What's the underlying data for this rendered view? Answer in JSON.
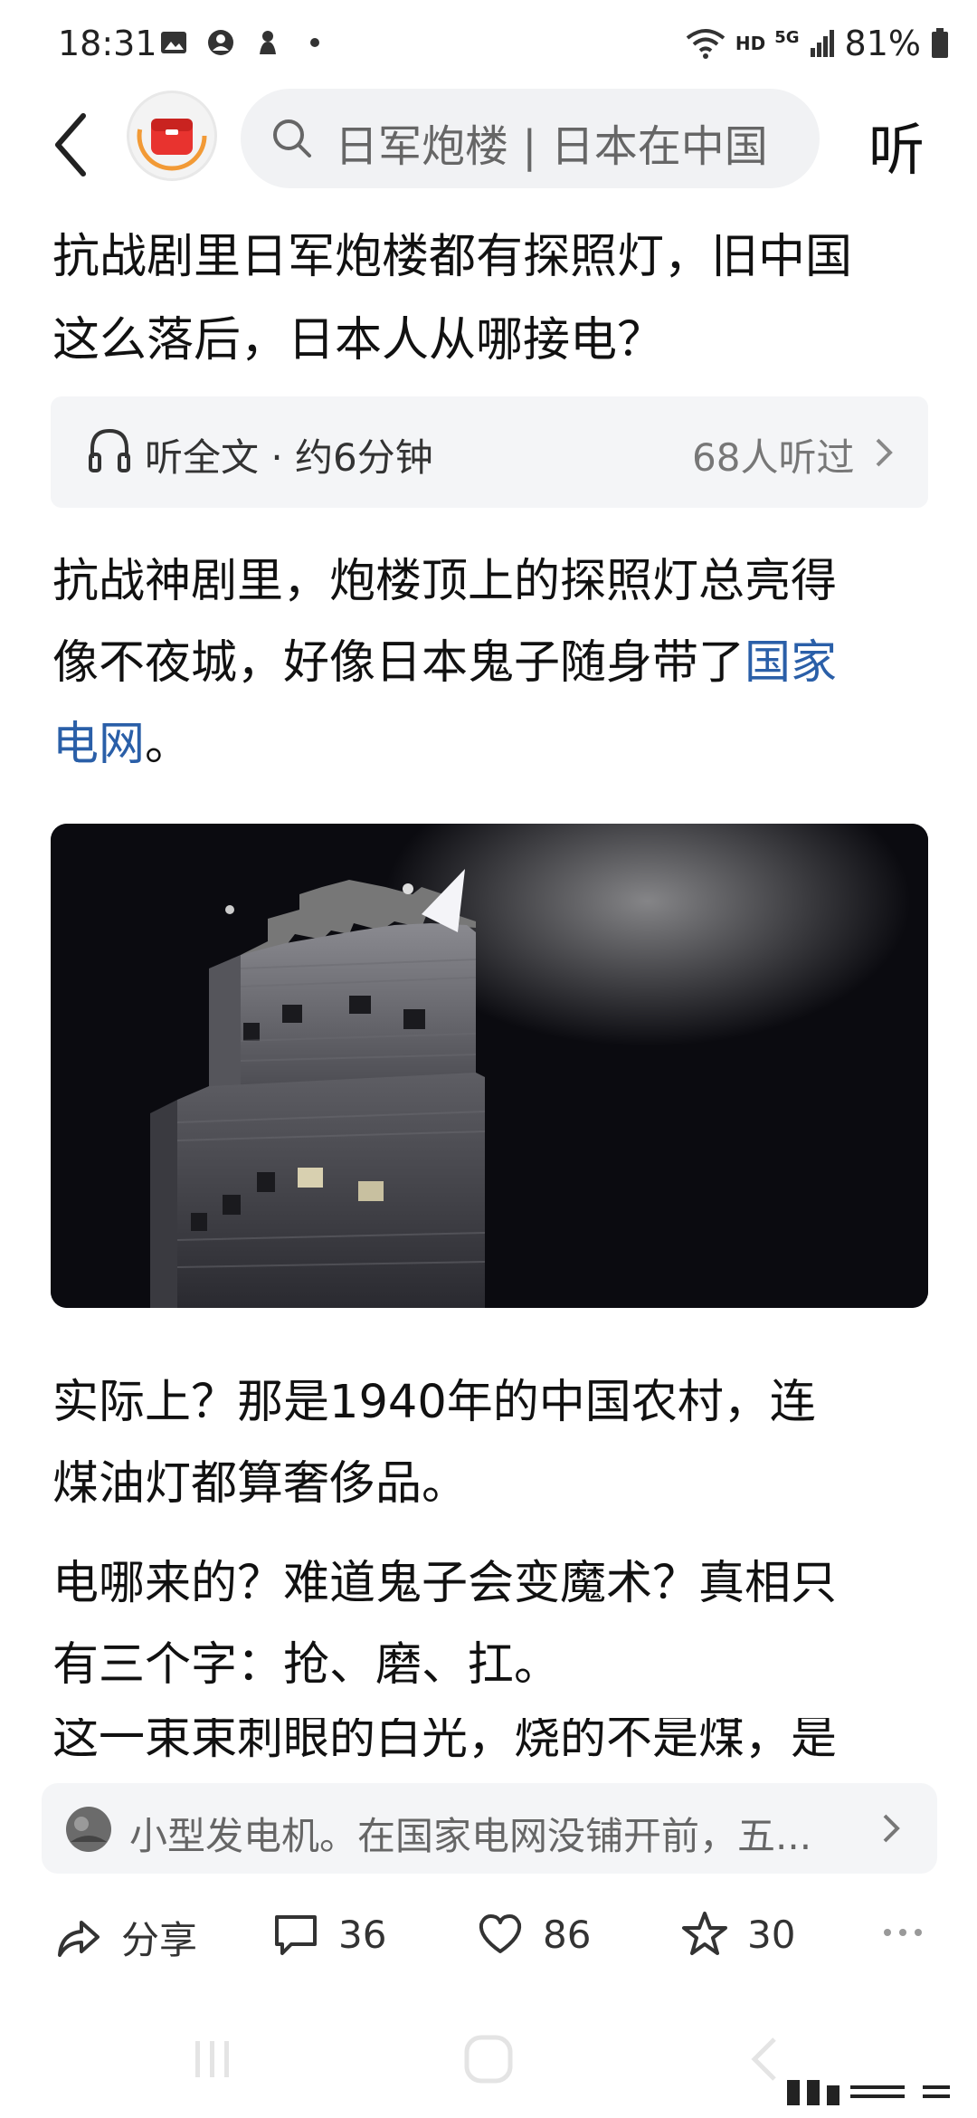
{
  "status_bar": {
    "time": "18:31",
    "network": "HD",
    "signal": "5G",
    "battery": "81%"
  },
  "nav": {
    "search_text": "日军炮楼 | 日本在中国",
    "listen_label": "听"
  },
  "article": {
    "title_line1": "抗战剧里日军炮楼都有探照灯，旧中国",
    "title_line2": "这么落后，日本人从哪接电？",
    "listen_card": {
      "label": "听全文 · 约6分钟",
      "count": "68人听过"
    },
    "para1_line1": "抗战神剧里，炮楼顶上的探照灯总亮得",
    "para1_line2_pre": "像不夜城，好像日本鬼子随身带了",
    "para1_link_part1": "国家",
    "para1_link_part2": "电网",
    "para1_end": "。",
    "para2_line1": "实际上？那是1940年的中国农村，连",
    "para2_line2": "煤油灯都算奢侈品。",
    "para3_line1": "电哪来的？难道鬼子会变魔术？真相只",
    "para3_line2": "有三个字：抢、磨、扛。",
    "para4_partial": "这一束束刺眼的白光，烧的不是煤，是"
  },
  "related": {
    "text": "小型发电机。在国家电网没铺开前，五..."
  },
  "actions": {
    "share": "分享",
    "comments": "36",
    "likes": "86",
    "favorites": "30"
  },
  "colors": {
    "link": "#2a5fa8",
    "logo_red": "#e8332f",
    "logo_orange": "#f29a36"
  }
}
